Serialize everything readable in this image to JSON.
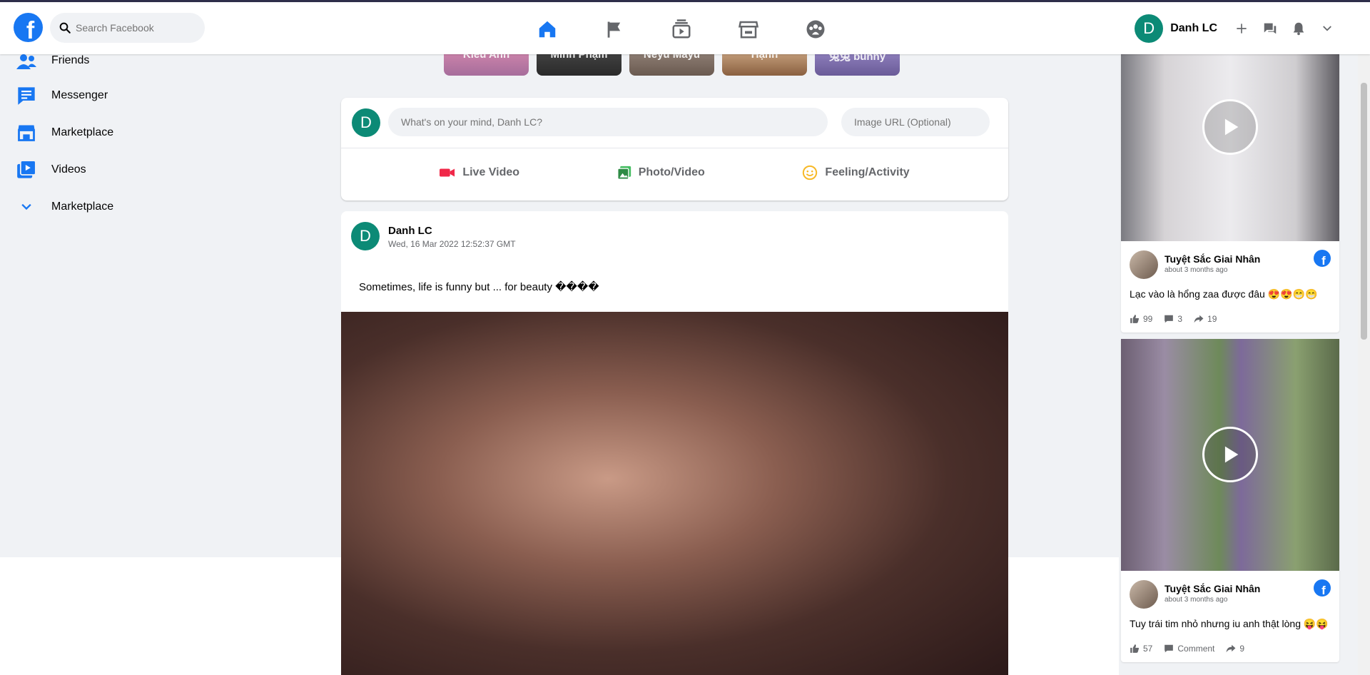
{
  "header": {
    "search_placeholder": "Search Facebook",
    "user_initial": "D",
    "user_name": "Danh LC"
  },
  "sidebar": {
    "items": [
      {
        "label": "Friends",
        "icon": "friends-icon"
      },
      {
        "label": "Messenger",
        "icon": "messenger-icon"
      },
      {
        "label": "Marketplace",
        "icon": "marketplace-icon"
      },
      {
        "label": "Videos",
        "icon": "videos-icon"
      },
      {
        "label": "Marketplace",
        "icon": "chevron-down-icon"
      }
    ]
  },
  "stories": [
    {
      "name": "Kieu Anh",
      "color": "#d98bb0"
    },
    {
      "name": "Minh Phạm",
      "color": "#3a3a3a"
    },
    {
      "name": "Neyu Mayu",
      "color": "#8a7a70"
    },
    {
      "name": "Hạnh",
      "color": "#c9a070"
    },
    {
      "name": "兔兔 bunny",
      "color": "#8a7bb8"
    }
  ],
  "composer": {
    "avatar_initial": "D",
    "mind_placeholder": "What's on your mind, Danh LC?",
    "image_url_placeholder": "Image URL (Optional)",
    "live_video": "Live Video",
    "photo_video": "Photo/Video",
    "feeling_activity": "Feeling/Activity"
  },
  "post": {
    "avatar_initial": "D",
    "author": "Danh LC",
    "time": "Wed, 16 Mar 2022 12:52:37 GMT",
    "text": "Sometimes, life is funny but ... for beauty ����"
  },
  "videos": [
    {
      "page": "Tuyệt Sắc Giai Nhân",
      "ago": "about 3 months ago",
      "caption": "Lạc vào là hổng zaa được đâu 😍😍😁😁",
      "likes": "99",
      "comments": "3",
      "shares": "19"
    },
    {
      "page": "Tuyệt Sắc Giai Nhân",
      "ago": "about 3 months ago",
      "caption": "Tuy trái tim nhỏ nhưng iu anh thật lòng 😝😝",
      "likes": "57",
      "comments": "Comment",
      "shares": "9"
    }
  ]
}
